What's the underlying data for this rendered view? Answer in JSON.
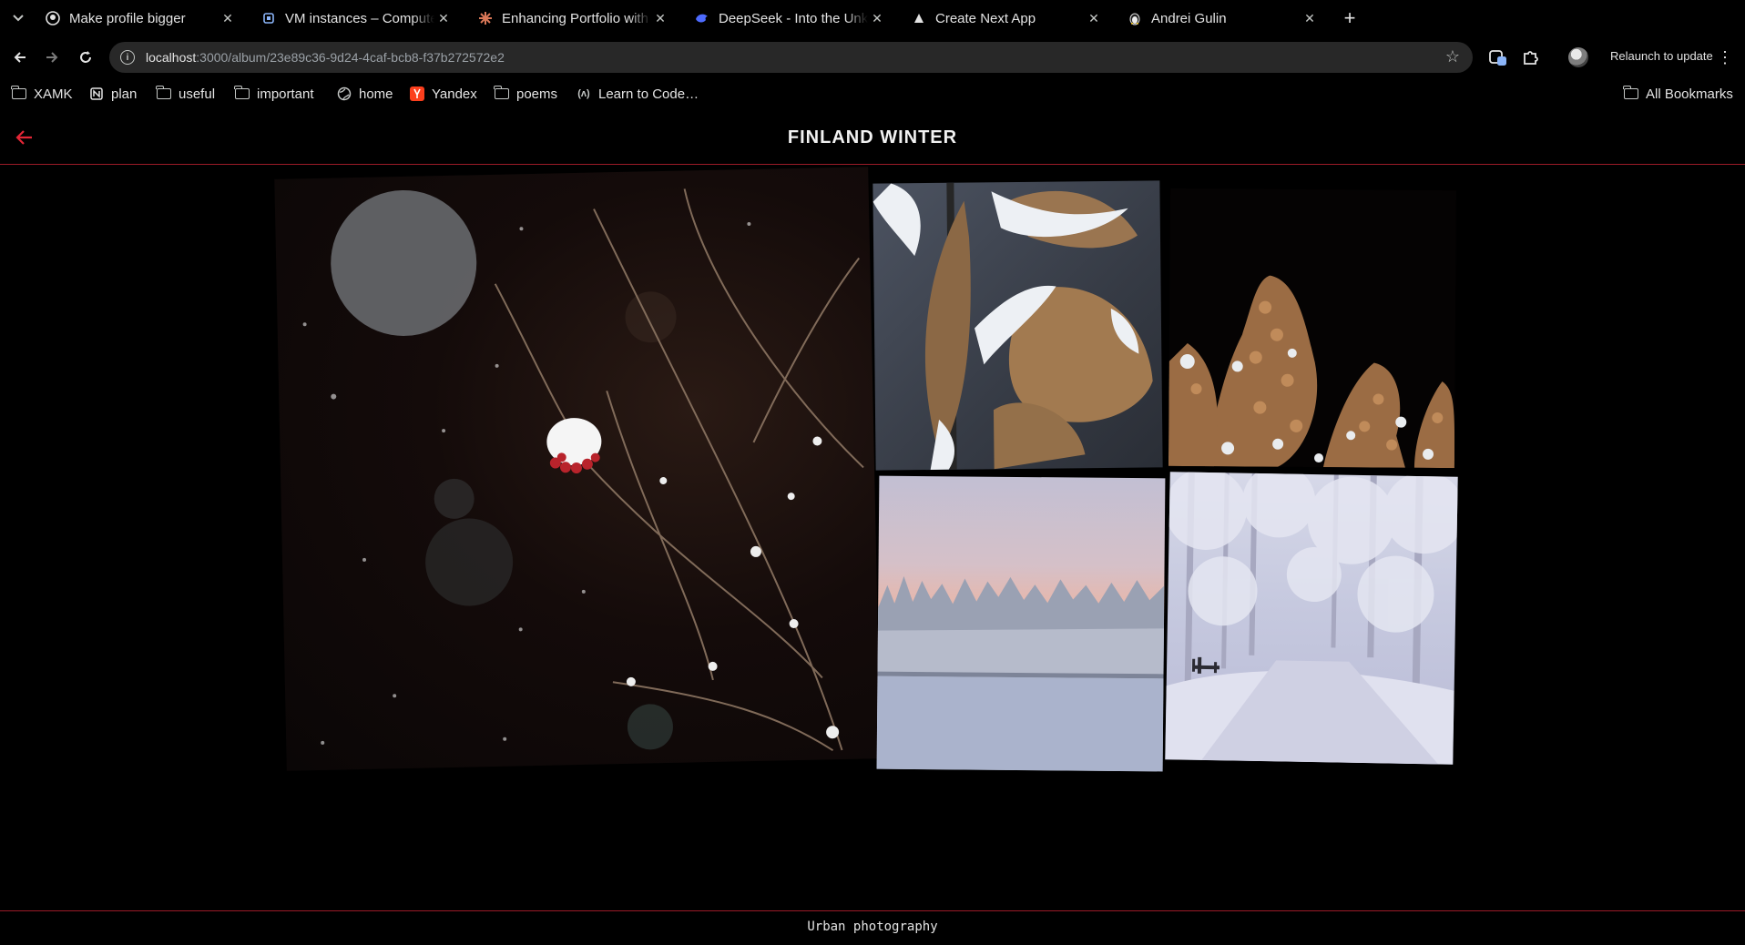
{
  "browser": {
    "tabs": [
      {
        "title": "Make profile bigger",
        "icon": "github-icon"
      },
      {
        "title": "VM instances – Compute Engine",
        "icon": "compute-engine-icon"
      },
      {
        "title": "Enhancing Portfolio with Next.js",
        "icon": "claude-icon"
      },
      {
        "title": "DeepSeek - Into the Unknown",
        "icon": "deepseek-icon"
      },
      {
        "title": "Create Next App",
        "icon": "vercel-triangle-icon"
      },
      {
        "title": "Andrei Gulin",
        "icon": "linux-penguin-icon"
      }
    ],
    "url": {
      "host": "localhost",
      "path": ":3000/album/23e89c36-9d24-4caf-bcb8-f37b272572e2"
    },
    "relaunch_label": "Relaunch to update",
    "bookmarks": [
      {
        "label": "XAMK",
        "icon": "folder-icon"
      },
      {
        "label": "plan",
        "icon": "notion-icon"
      },
      {
        "label": "useful",
        "icon": "folder-icon"
      },
      {
        "label": "important",
        "icon": "folder-icon"
      },
      {
        "label": "home",
        "icon": "globe-icon"
      },
      {
        "label": "Yandex",
        "icon": "yandex-icon"
      },
      {
        "label": "poems",
        "icon": "folder-icon"
      },
      {
        "label": "Learn to Code…",
        "icon": "freecodecamp-icon"
      }
    ],
    "all_bookmarks_label": "All Bookmarks"
  },
  "page": {
    "title": "FINLAND WINTER",
    "footer": "Urban photography",
    "accent_color": "#e32636",
    "photos": [
      {
        "subject": "snow-capped rowan berries at night"
      },
      {
        "subject": "snowy dry oak leaves"
      },
      {
        "subject": "frosted brown seed clusters"
      },
      {
        "subject": "frozen lake with snowy forest at dusk"
      },
      {
        "subject": "snowy park path with bench"
      }
    ]
  }
}
